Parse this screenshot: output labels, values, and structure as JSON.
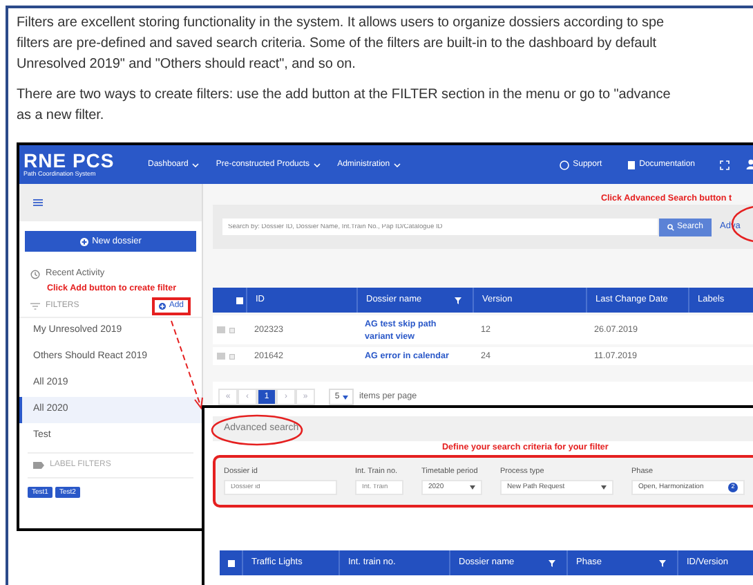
{
  "article": {
    "paragraphs": [
      {
        "lines": [
          "Filters are excellent storing functionality in the system. It allows users to organize dossiers according to spe",
          "filters are pre-defined and saved search criteria. Some of the filters are built-in to the dashboard by default",
          "Unresolved 2019\" and \"Others should react\", and so on."
        ]
      },
      {
        "lines": [
          "There are two ways to create filters: use the add button at the FILTER section in the menu or go to \"advance",
          "as a new filter."
        ]
      }
    ]
  },
  "main_screenshot": {
    "header": {
      "logo": "RNE PCS",
      "logo_subtitle": "Path Coordination System",
      "nav": [
        "Dashboard",
        "Pre-constructed Products",
        "Administration"
      ],
      "support": "Support",
      "documentation": "Documentation"
    },
    "sidebar": {
      "new_button": "New dossier",
      "recent": "Recent Activity",
      "annotation": "Click Add button to create filter",
      "filters_heading": "FILTERS",
      "add_button": "Add",
      "filters": [
        {
          "label": "My Unresolved 2019",
          "selected": false
        },
        {
          "label": "Others Should React 2019",
          "selected": false
        },
        {
          "label": "All 2019",
          "selected": false
        },
        {
          "label": "All 2020",
          "selected": true
        },
        {
          "label": "Test",
          "selected": false
        }
      ],
      "label_filters_heading": "LABEL FILTERS",
      "tags": [
        "Test1",
        "Test2"
      ]
    },
    "annotation": "Click Advanced Search button t",
    "search": {
      "placeholder": "Search by: Dossier ID, Dossier Name, Int.Train No., Pap ID/Catalogue ID",
      "button": "Search",
      "advanced_link": "Adva"
    },
    "table": {
      "columns": [
        {
          "label": "ID",
          "filter": false
        },
        {
          "label": "Dossier name",
          "filter": true
        },
        {
          "label": "Version",
          "filter": false
        },
        {
          "label": "Last Change Date",
          "filter": false
        },
        {
          "label": "Labels",
          "filter": false
        }
      ],
      "rows": [
        {
          "id": "202323",
          "name": "AG test skip path variant view",
          "version": "12",
          "date": "26.07.2019"
        },
        {
          "id": "201642",
          "name": "AG error in calendar",
          "version": "24",
          "date": "11.07.2019"
        }
      ]
    },
    "pagination": {
      "items": [
        {
          "kind": "nav",
          "label": "«"
        },
        {
          "kind": "nav",
          "label": "‹"
        },
        {
          "kind": "page",
          "label": "1",
          "selected": true
        },
        {
          "kind": "nav",
          "label": "›"
        },
        {
          "kind": "nav",
          "label": "»"
        }
      ],
      "per_page": "5",
      "per_page_label": "items per page"
    }
  },
  "advanced_screenshot": {
    "title": "Advanced search",
    "annotation": "Define your search criteria for your filter",
    "fields": [
      {
        "kind": "input",
        "label": "Dossier id",
        "placeholder": "Dossier id"
      },
      {
        "kind": "input",
        "label": "Int. Train no.",
        "placeholder": "Int. Train"
      },
      {
        "kind": "select",
        "label": "Timetable period",
        "value": "2020"
      },
      {
        "kind": "select",
        "label": "Process type",
        "value": "New Path Request"
      },
      {
        "kind": "multi",
        "label": "Phase",
        "value": "Open, Harmonization",
        "count": "2"
      }
    ],
    "table": {
      "columns": [
        {
          "label": "Traffic Lights",
          "filter": false
        },
        {
          "label": "Int. train no.",
          "filter": false
        },
        {
          "label": "Dossier name",
          "filter": true
        },
        {
          "label": "Phase",
          "filter": true
        },
        {
          "label": "ID/Version",
          "filter": false
        }
      ]
    }
  }
}
